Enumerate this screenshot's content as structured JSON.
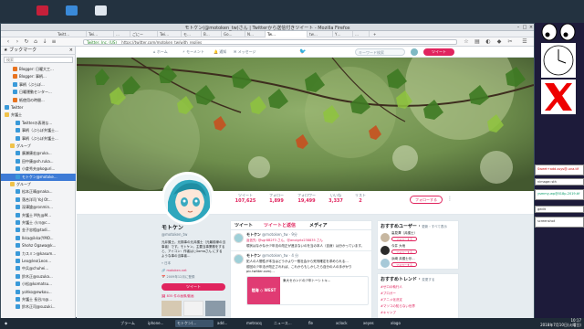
{
  "window": {
    "title": "モトケン(@motoken_tw)さん | Twitterから送信付きツイート - Mozilla Firefox",
    "url_secure": "Twitter, Inc. (US)",
    "url": "https://twitter.com/motoken_tw/with_replies"
  },
  "tabs": [
    "Twitt…",
    "Twi…",
    "…",
    "ごにー",
    "Twi…",
    "モ…",
    "B…",
    "Go…",
    "N…",
    "Tw…",
    "tw…",
    "Y…",
    "…"
  ],
  "sidebar": {
    "header": "ブックマーク",
    "search_placeholder": "検索",
    "items": [
      {
        "label": "Blogger: 日曜大工...",
        "color": "#e8731f"
      },
      {
        "label": "Blogger: 事柄...",
        "color": "#e8731f"
      },
      {
        "label": "事柄（ぶらぼ...",
        "color": "#3a9ad9"
      },
      {
        "label": "日曜運動センター...",
        "color": "#3a9ad9"
      },
      {
        "label": "紙使用の時間...",
        "color": "#e8731f"
      },
      {
        "label": "Twitter",
        "color": "#3a9ad9"
      },
      {
        "label": "弁護士",
        "color": "#f0c24a"
      },
      {
        "label": "Twitterの表現な...",
        "color": "#3a9ad9"
      },
      {
        "label": "事柄（ぶらぼ弁護士...",
        "color": "#3a9ad9"
      },
      {
        "label": "事柄（ぶらぼ弁護士...",
        "color": "#3a9ad9"
      },
      {
        "label": "グループ",
        "color": "#f0c24a"
      },
      {
        "label": "廣瀬康宏@ruka...",
        "color": "#3a9ad9"
      },
      {
        "label": "田中康@sh.ruka...",
        "color": "#3a9ad9"
      },
      {
        "label": "小倉秀夫@koguri...",
        "color": "#3a9ad9"
      },
      {
        "label": "モトケン@motoke...",
        "color": "#3a9ad9"
      },
      {
        "label": "グループ",
        "color": "#f0c24a"
      },
      {
        "label": "松本正晴@naka...",
        "color": "#3a9ad9"
      },
      {
        "label": "落合洋司 YoJ Ot...",
        "color": "#3a9ad9"
      },
      {
        "label": "深澤論@ronmin...",
        "color": "#3a9ad9"
      },
      {
        "label": "弁護士 M先@M...",
        "color": "#3a9ad9"
      },
      {
        "label": "弁護士 小川@c...",
        "color": "#3a9ad9"
      },
      {
        "label": "金子忠相@tadi...",
        "color": "#3a9ad9"
      },
      {
        "label": "Ikka@ikka(YMO...",
        "color": "#3a9ad9"
      },
      {
        "label": "Shohz Ogawa@k...",
        "color": "#3a9ad9"
      },
      {
        "label": "カスミン@kasum...",
        "color": "#3a9ad9"
      },
      {
        "label": "Leo@leo(Leon...",
        "color": "#3a9ad9"
      },
      {
        "label": "中兵@chuhei...",
        "color": "#3a9ad9"
      },
      {
        "label": "鈴木正@suzuka...",
        "color": "#3a9ad9"
      },
      {
        "label": "小松@komatsu...",
        "color": "#3a9ad9"
      },
      {
        "label": "yohko@ewkou...",
        "color": "#3a9ad9"
      },
      {
        "label": "弁護士 長谷川@...",
        "color": "#3a9ad9"
      },
      {
        "label": "鈴木正司@suzuki...",
        "color": "#3a9ad9"
      }
    ],
    "selected_index": 14
  },
  "twitter_nav": {
    "home": "ホーム",
    "moments": "モーメント",
    "notifications": "通知",
    "messages": "メッセージ",
    "search_placeholder": "キーワード検索",
    "tweet_button": "ツイート"
  },
  "stats": [
    {
      "key": "ツイート",
      "value": "107,625"
    },
    {
      "key": "フォロー",
      "value": "1,899"
    },
    {
      "key": "フォロワー",
      "value": "19,499"
    },
    {
      "key": "いいね",
      "value": "3,337"
    },
    {
      "key": "リスト",
      "value": "2"
    }
  ],
  "follow_button": "フォローする",
  "profile": {
    "name": "モトケン",
    "handle": "@motoken_tw",
    "bio": "元弁護士。元検事の元弁護士（元最前線の当事者）です。モトケン。主要当事業務をすると、アイコン：作者はI_Gomaさん にするような事の当事者…",
    "location": "日本",
    "link": "motoken.net",
    "joined": "2009年12月に登録",
    "tweet_button": "ツイート",
    "photos": "835 件の画像/動画"
  },
  "timeline": {
    "tabs": [
      "ツイート",
      "ツイートと返信",
      "メディア"
    ],
    "active_tab": 1,
    "tweets": [
      {
        "name": "モトケン",
        "handle": "@motoken_tw · 9分",
        "text": "返信先: @sgr8B2F3 さん、@anolgrtz238835 さん",
        "text2": "現状はなかなか少年法の改正が進まないのを当の本人（自身）は分かっています。"
      },
      {
        "name": "モトケン",
        "handle": "@motoken_tw · 4 分",
        "text": "犯人の人間性が本当はどうかより一般社会から死刑確定を求められる…",
        "text2": "前回の少年法が改正されれば、これからもしかしたら自分の人の手がかり pic.twitter.com/…",
        "card_img": "陸海 ◇ WEST",
        "card_text": "東大セカンドの少年トーシトキ…"
      }
    ]
  },
  "who_to_follow": {
    "title": "おすすめユーザー",
    "meta": "更新・すべて表示",
    "users": [
      {
        "name": "高見澤（弁護士）",
        "button": "フォローする"
      },
      {
        "name": "今井 大地",
        "button": "フォローする"
      },
      {
        "name": "浜崎 弁護士@…",
        "button": "フォローする"
      }
    ]
  },
  "trends": {
    "title": "おすすめトレンド",
    "meta": "変更する",
    "items": [
      "#ゼロの執行人",
      "#ブロガー",
      "#アニメ化決定",
      "#マツコの知らない世界",
      "#キャンプ"
    ]
  },
  "desktop": {
    "widgets": [
      "Sweet+add-ssys@-una.tif",
      "nimage::sth",
      "ysmmy-wp@018p-2019.tif",
      "gedit",
      "screenshot"
    ]
  },
  "taskbar": {
    "items": [
      "ブラーム",
      "iphone...",
      "モトケン(...",
      "add...",
      "metrocq",
      "ニュース...",
      "fle",
      "xclock",
      "xeyes",
      "xlogo"
    ],
    "time": "10:17",
    "date": "2018年7月10日(火曜日)"
  }
}
